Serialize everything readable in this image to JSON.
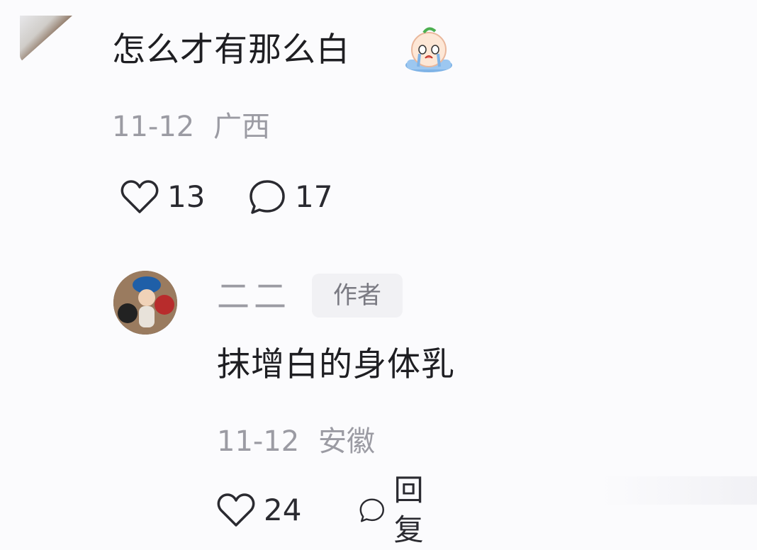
{
  "comment": {
    "text": "怎么才有那么白",
    "emoji": "crying-face-emoji",
    "date": "11-12",
    "location": "广西",
    "likes": "13",
    "replies": "17"
  },
  "reply": {
    "username": "二二",
    "badge": "作者",
    "text": "抹增白的身体乳",
    "date": "11-12",
    "location": "安徽",
    "likes": "24",
    "reply_label": "回复"
  },
  "colors": {
    "text_primary": "#1e1e22",
    "text_secondary": "#9b9ba3",
    "badge_bg": "#f1f1f4",
    "background": "#fbfbfd"
  }
}
